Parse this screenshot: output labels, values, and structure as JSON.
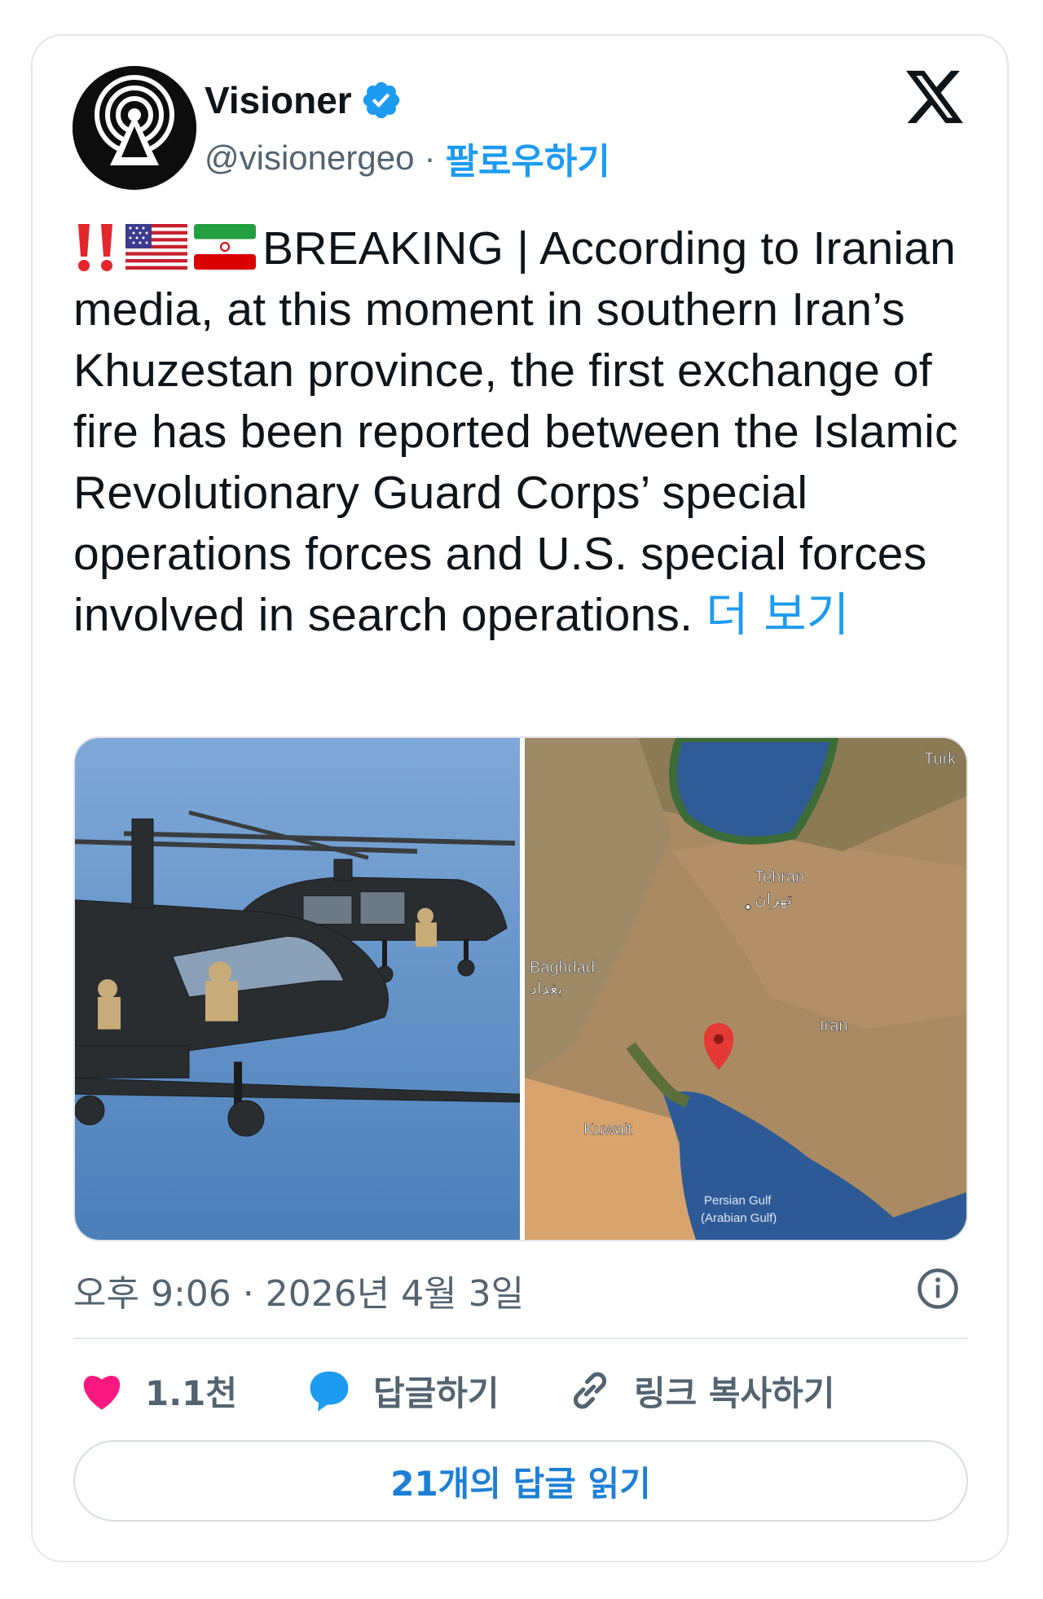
{
  "author": {
    "display_name": "Visioner",
    "handle": "@visionergeo",
    "separator": "·",
    "follow_label": "팔로우하기"
  },
  "tweet": {
    "text": "BREAKING | According to Iranian media, at this moment in southern Iran’s Khuzestan province, the first exchange of fire has been reported between the Islamic Revolutionary Guard Corps’ special operations forces and U.S. special forces involved in search operations.",
    "more_label": "더 보기",
    "emojis": [
      "double-exclamation",
      "us-flag",
      "iran-flag"
    ]
  },
  "media": {
    "map_labels": {
      "turkey": "Turk",
      "tehran": "Tehran",
      "tehran_native": "تهران",
      "baghdad": "Baghdad",
      "baghdad_native": "بغداد",
      "iran": "Iran",
      "kuwait": "Kuwait",
      "gulf_line1": "Persian Gulf",
      "gulf_line2": "(Arabian Gulf)"
    }
  },
  "timestamp": "오후 9:06 · 2026년 4월 3일",
  "actions": {
    "likes": "1.1천",
    "reply": "답글하기",
    "copy_link": "링크 복사하기"
  },
  "read_replies": "21개의 답글 읽기",
  "colors": {
    "accent": "#1d9bf0",
    "like": "#f91880",
    "muted": "#536471"
  }
}
